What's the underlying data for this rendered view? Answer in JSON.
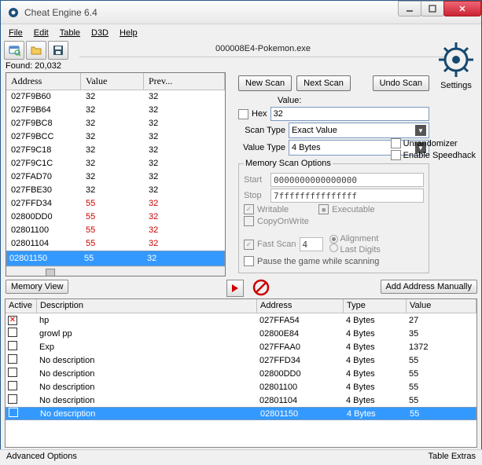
{
  "title": "Cheat Engine 6.4",
  "menubar": [
    "File",
    "Edit",
    "Table",
    "D3D",
    "Help"
  ],
  "process_name": "000008E4-Pokemon.exe",
  "logo_caption": "Settings",
  "found_label": "Found: 20,032",
  "results_headers": {
    "address": "Address",
    "value": "Value",
    "prev": "Prev..."
  },
  "results": [
    {
      "addr": "027F9B60",
      "val": "32",
      "prev": "32",
      "red": false
    },
    {
      "addr": "027F9B64",
      "val": "32",
      "prev": "32",
      "red": false
    },
    {
      "addr": "027F9BC8",
      "val": "32",
      "prev": "32",
      "red": false
    },
    {
      "addr": "027F9BCC",
      "val": "32",
      "prev": "32",
      "red": false
    },
    {
      "addr": "027F9C18",
      "val": "32",
      "prev": "32",
      "red": false
    },
    {
      "addr": "027F9C1C",
      "val": "32",
      "prev": "32",
      "red": false
    },
    {
      "addr": "027FAD70",
      "val": "32",
      "prev": "32",
      "red": false
    },
    {
      "addr": "027FBE30",
      "val": "32",
      "prev": "32",
      "red": false
    },
    {
      "addr": "027FFD34",
      "val": "55",
      "prev": "32",
      "red": true
    },
    {
      "addr": "02800DD0",
      "val": "55",
      "prev": "32",
      "red": true
    },
    {
      "addr": "02801100",
      "val": "55",
      "prev": "32",
      "red": true
    },
    {
      "addr": "02801104",
      "val": "55",
      "prev": "32",
      "red": true
    },
    {
      "addr": "02801150",
      "val": "55",
      "prev": "32",
      "red": true,
      "sel": true
    }
  ],
  "memory_view_btn": "Memory View",
  "scan": {
    "new_scan": "New Scan",
    "next_scan": "Next Scan",
    "undo_scan": "Undo Scan",
    "value_label": "Value:",
    "hex_label": "Hex",
    "value_input": "32",
    "scan_type_label": "Scan Type",
    "scan_type_value": "Exact Value",
    "value_type_label": "Value Type",
    "value_type_value": "4 Bytes",
    "mem_options_legend": "Memory Scan Options",
    "start_label": "Start",
    "start_value": "0000000000000000",
    "stop_label": "Stop",
    "stop_value": "7fffffffffffffff",
    "writable": "Writable",
    "executable": "Executable",
    "cow": "CopyOnWrite",
    "fast_scan": "Fast Scan",
    "fast_scan_value": "4",
    "alignment": "Alignment",
    "last_digits": "Last Digits",
    "pause_label": "Pause the game while scanning",
    "unrandomizer": "Unrandomizer",
    "speedhack": "Enable Speedhack"
  },
  "add_manual_btn": "Add Address Manually",
  "cheat_headers": {
    "active": "Active",
    "desc": "Description",
    "addr": "Address",
    "type": "Type",
    "val": "Value"
  },
  "cheat_rows": [
    {
      "active_x": true,
      "desc": "hp",
      "addr": "027FFA54",
      "type": "4 Bytes",
      "val": "27"
    },
    {
      "active_x": false,
      "desc": "growl pp",
      "addr": "02800E84",
      "type": "4 Bytes",
      "val": "35"
    },
    {
      "active_x": false,
      "desc": "Exp",
      "addr": "027FFAA0",
      "type": "4 Bytes",
      "val": "1372"
    },
    {
      "active_x": false,
      "desc": "No description",
      "addr": "027FFD34",
      "type": "4 Bytes",
      "val": "55"
    },
    {
      "active_x": false,
      "desc": "No description",
      "addr": "02800DD0",
      "type": "4 Bytes",
      "val": "55"
    },
    {
      "active_x": false,
      "desc": "No description",
      "addr": "02801100",
      "type": "4 Bytes",
      "val": "55"
    },
    {
      "active_x": false,
      "desc": "No description",
      "addr": "02801104",
      "type": "4 Bytes",
      "val": "55"
    },
    {
      "active_x": false,
      "desc": "No description",
      "addr": "02801150",
      "type": "4 Bytes",
      "val": "55",
      "sel": true
    }
  ],
  "status": {
    "left": "Advanced Options",
    "right": "Table Extras"
  }
}
